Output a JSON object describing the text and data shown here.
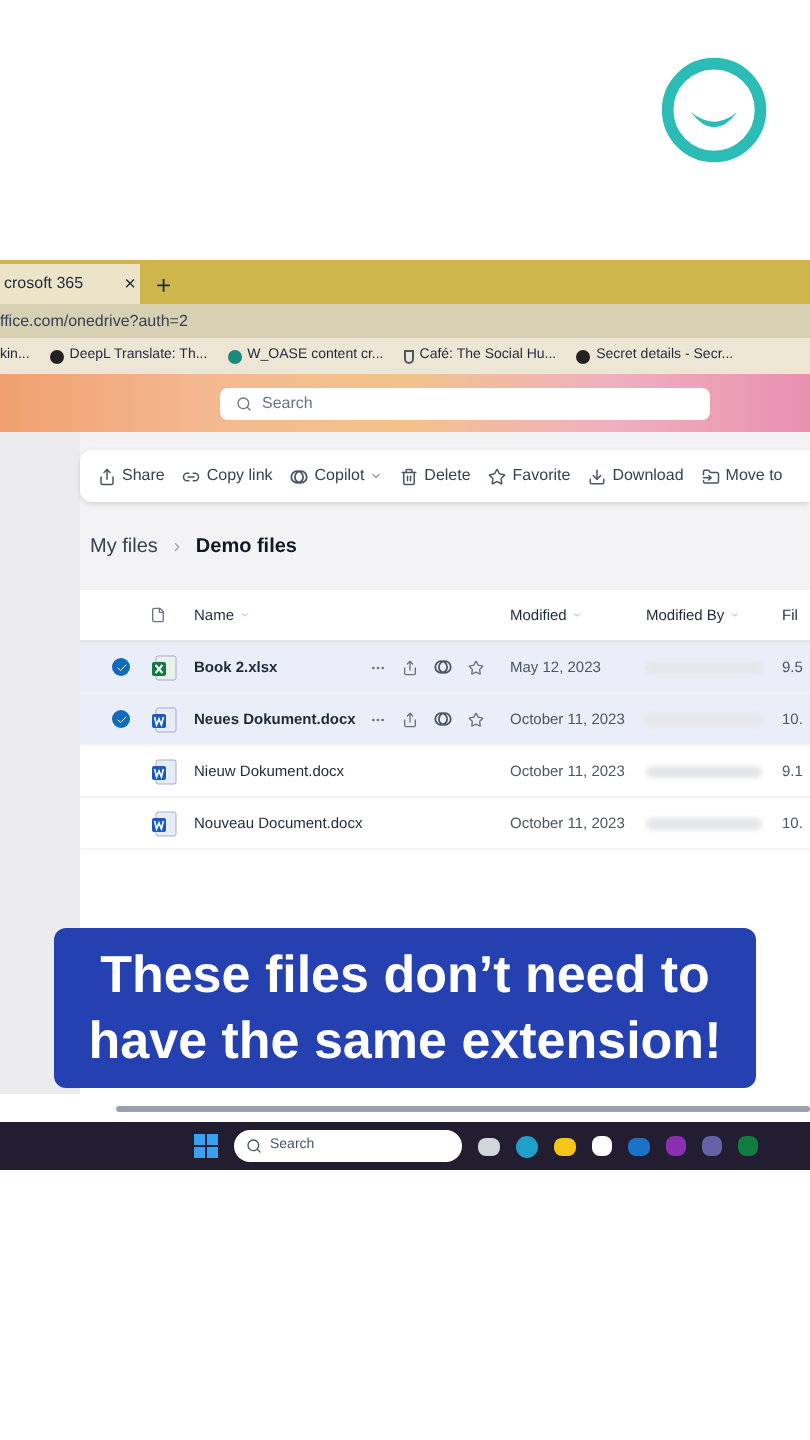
{
  "browser": {
    "tab_title": "crosoft 365",
    "tab_close": "×",
    "new_tab": "+",
    "address": "ffice.com/onedrive?auth=2",
    "bookmarks": [
      {
        "label": "kin...",
        "kind": "plain"
      },
      {
        "label": "DeepL Translate: Th...",
        "kind": "dark"
      },
      {
        "label": "W_OASE content cr...",
        "kind": "teal"
      },
      {
        "label": "Café: The Social Hu...",
        "kind": "cup"
      },
      {
        "label": "Secret details - Secr...",
        "kind": "dark"
      }
    ]
  },
  "search": {
    "placeholder": "Search"
  },
  "toolbar": [
    {
      "label": "Share",
      "kind": "share",
      "menu": false
    },
    {
      "label": "Copy link",
      "kind": "link",
      "menu": false
    },
    {
      "label": "Copilot",
      "kind": "copilot",
      "menu": true
    },
    {
      "label": "Delete",
      "kind": "delete",
      "menu": false
    },
    {
      "label": "Favorite",
      "kind": "star",
      "menu": false
    },
    {
      "label": "Download",
      "kind": "download",
      "menu": false
    },
    {
      "label": "Move to",
      "kind": "move",
      "menu": false
    }
  ],
  "breadcrumb": [
    "My files",
    "Demo files"
  ],
  "table": {
    "columns": [
      {
        "label": "Name",
        "sortable": true
      },
      {
        "label": "Modified",
        "sortable": true
      },
      {
        "label": "Modified By",
        "sortable": true
      },
      {
        "label": "Fil",
        "sortable": false
      }
    ],
    "rows": [
      {
        "name": "Book 2.xlsx",
        "kind": "excel",
        "selected": true,
        "modified": "May 12, 2023",
        "size": "9.5"
      },
      {
        "name": "Neues Dokument.docx",
        "kind": "word",
        "selected": true,
        "modified": "October 11, 2023",
        "size": "10."
      },
      {
        "name": "Nieuw Dokument.docx",
        "kind": "word",
        "selected": false,
        "modified": "October 11, 2023",
        "size": "9.1"
      },
      {
        "name": "Nouveau Document.docx",
        "kind": "word",
        "selected": false,
        "modified": "October 11, 2023",
        "size": "10."
      }
    ]
  },
  "caption": "These files don’t need to have the same extension!",
  "taskbar": {
    "search_placeholder": "Search"
  }
}
